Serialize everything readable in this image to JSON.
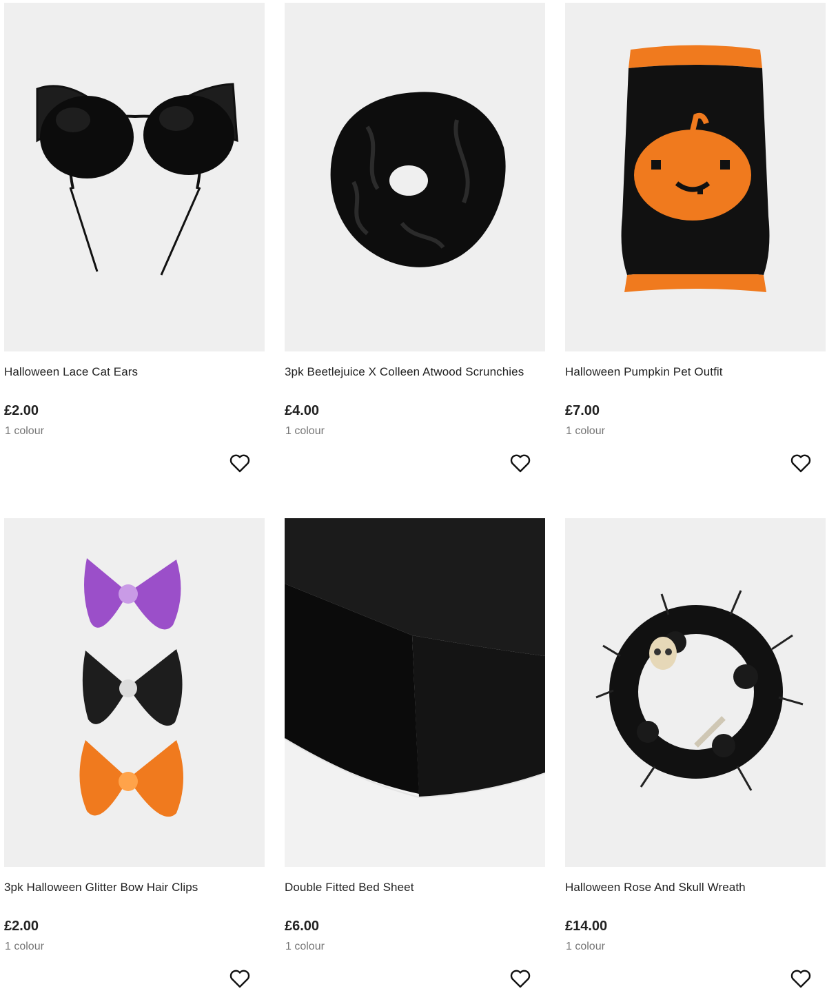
{
  "products": [
    {
      "title": "Halloween Lace Cat Ears",
      "price": "£2.00",
      "colours": "1 colour",
      "image_icon": "cat-ears-headband-icon",
      "wishlist_icon": "heart-outline-icon"
    },
    {
      "title": "3pk Beetlejuice X Colleen Atwood Scrunchies",
      "price": "£4.00",
      "colours": "1 colour",
      "image_icon": "lace-scrunchie-icon",
      "wishlist_icon": "heart-outline-icon"
    },
    {
      "title": "Halloween Pumpkin Pet Outfit",
      "price": "£7.00",
      "colours": "1 colour",
      "image_icon": "pumpkin-pet-jumper-icon",
      "wishlist_icon": "heart-outline-icon"
    },
    {
      "title": "3pk Halloween Glitter Bow Hair Clips",
      "price": "£2.00",
      "colours": "1 colour",
      "image_icon": "bow-hair-clips-icon",
      "wishlist_icon": "heart-outline-icon"
    },
    {
      "title": "Double Fitted Bed Sheet",
      "price": "£6.00",
      "colours": "1 colour",
      "image_icon": "fitted-bed-sheet-icon",
      "wishlist_icon": "heart-outline-icon"
    },
    {
      "title": "Halloween Rose And Skull Wreath",
      "price": "£14.00",
      "colours": "1 colour",
      "image_icon": "rose-skull-wreath-icon",
      "wishlist_icon": "heart-outline-icon"
    }
  ],
  "colors": {
    "image_background": "#efefef",
    "text": "#222222",
    "muted_text": "#757575",
    "pumpkin_orange": "#f07a1e",
    "glitter_purple": "#9b4fc9"
  }
}
